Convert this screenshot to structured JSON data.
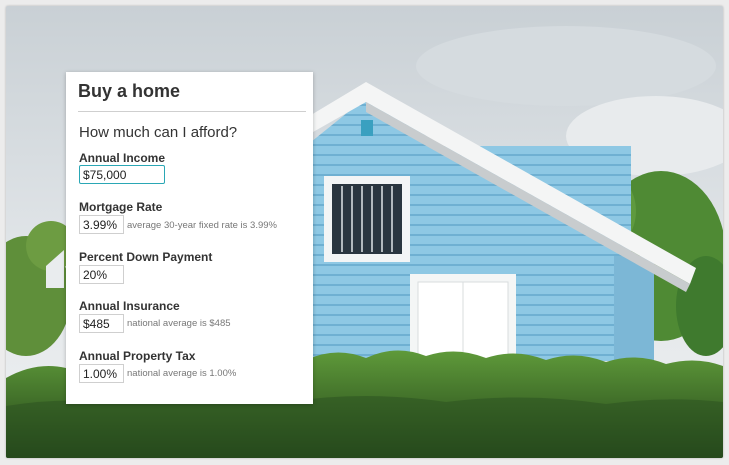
{
  "panel": {
    "title": "Buy a home",
    "question": "How much can I afford?"
  },
  "fields": {
    "income": {
      "label": "Annual Income",
      "value": "$75,000"
    },
    "rate": {
      "label": "Mortgage Rate",
      "value": "3.99%",
      "hint": "average 30-year fixed rate is 3.99%"
    },
    "down": {
      "label": "Percent Down Payment",
      "value": "20%"
    },
    "insurance": {
      "label": "Annual Insurance",
      "value": "$485",
      "hint": "national average is $485"
    },
    "tax": {
      "label": "Annual Property Tax",
      "value": "1.00%",
      "hint": "national average is 1.00%"
    }
  },
  "colors": {
    "accent": "#2aa7b5",
    "house_siding": "#8cc7e3",
    "hedge": "#3f7a2e"
  },
  "background_image": "blue-house-behind-hedge-photo"
}
